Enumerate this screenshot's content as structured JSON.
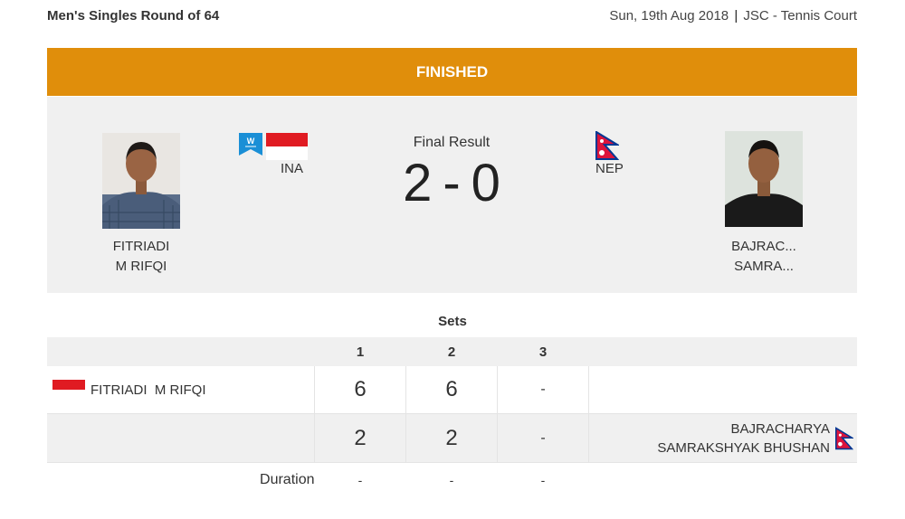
{
  "header": {
    "event": "Men's Singles Round of 64",
    "date": "Sun, 19th Aug 2018",
    "separator": "|",
    "venue": "JSC - Tennis Court"
  },
  "status": "FINISHED",
  "match": {
    "final_label": "Final Result",
    "score_left": "2",
    "score_dash": "-",
    "score_right": "0",
    "player_left": {
      "name_line1": "FITRIADI",
      "name_line2": "M RIFQI",
      "country_code": "INA",
      "winner_badge": "W"
    },
    "player_right": {
      "name_line1": "BAJRAC...",
      "name_line2": "SAMRA...",
      "country_code": "NEP"
    }
  },
  "sets": {
    "title": "Sets",
    "columns": [
      "1",
      "2",
      "3"
    ],
    "rows": [
      {
        "name": "FITRIADI  M RIFQI",
        "scores": [
          "6",
          "6",
          "-"
        ]
      },
      {
        "name_line1": "BAJRACHARYA",
        "name_line2": "SAMRAKSHYAK BHUSHAN",
        "scores": [
          "2",
          "2",
          "-"
        ]
      }
    ],
    "duration_label": "Duration",
    "durations": [
      "-",
      "-",
      "-"
    ]
  },
  "colors": {
    "status_bar": "#e08e0b",
    "panel": "#f0f0f0",
    "badge": "#1a8fd6",
    "nepal_red": "#dc143c",
    "nepal_blue": "#003893",
    "indonesia_red": "#e01b22"
  },
  "icons": {
    "winner": "winner-badge-icon",
    "flag_left": "indonesia-flag-icon",
    "flag_right": "nepal-flag-icon"
  }
}
